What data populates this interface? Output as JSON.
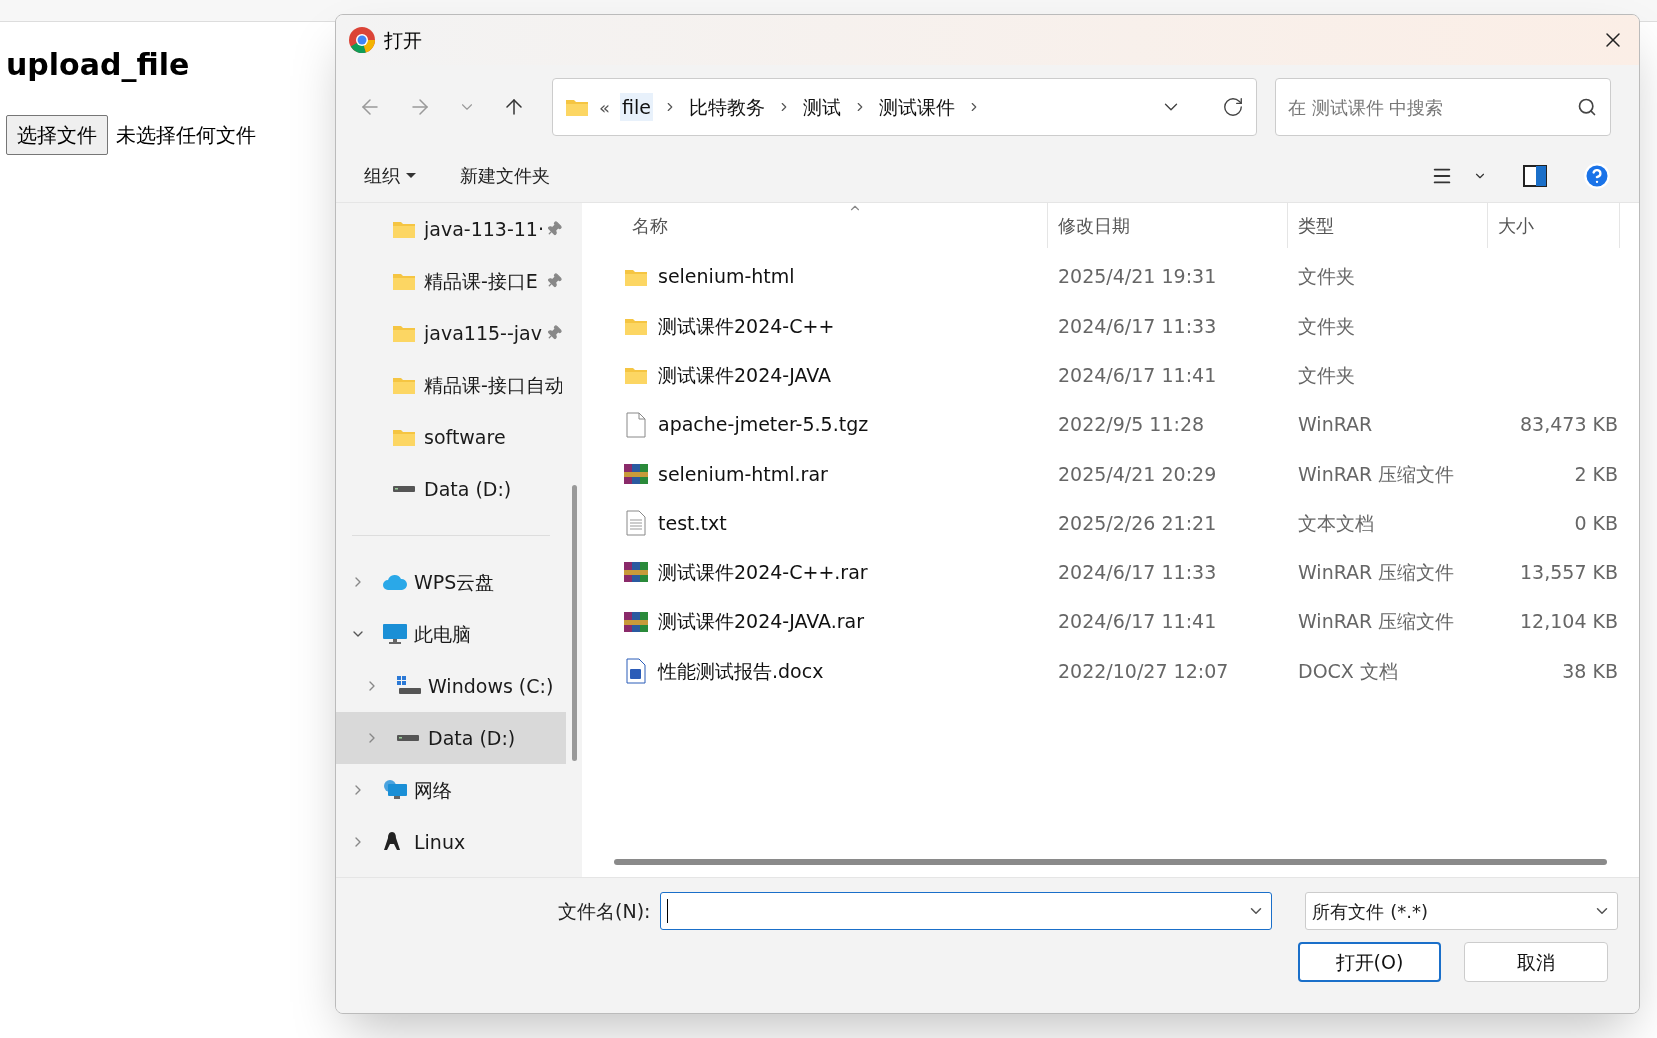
{
  "page": {
    "heading": "upload_file",
    "file_button": "选择文件",
    "file_status": "未选择任何文件"
  },
  "dialog": {
    "title": "打开",
    "breadcrumb": {
      "overflow": "«",
      "segments": [
        {
          "label": "file",
          "selected": true
        },
        {
          "label": "比特教务",
          "selected": false
        },
        {
          "label": "测试",
          "selected": false
        },
        {
          "label": "测试课件",
          "selected": false
        }
      ]
    },
    "search": {
      "placeholder": "在 测试课件 中搜索"
    },
    "toolbar": {
      "organize": "组织",
      "new_folder": "新建文件夹"
    },
    "quick_access": [
      {
        "label": "java-113-11·",
        "kind": "folder",
        "pinned": true
      },
      {
        "label": "精品课-接口E",
        "kind": "folder",
        "pinned": true
      },
      {
        "label": "java115--jav",
        "kind": "folder",
        "pinned": true
      },
      {
        "label": "精品课-接口自动",
        "kind": "folder",
        "pinned": false
      },
      {
        "label": "software",
        "kind": "folder",
        "pinned": false
      },
      {
        "label": "Data (D:)",
        "kind": "drive",
        "pinned": false
      }
    ],
    "tree": [
      {
        "label": "WPS云盘",
        "kind": "cloud",
        "expanded": false,
        "selected": false
      },
      {
        "label": "此电脑",
        "kind": "pc",
        "expanded": true,
        "selected": false,
        "children": [
          {
            "label": "Windows (C:)",
            "kind": "system-drive",
            "expanded": false,
            "selected": false
          },
          {
            "label": "Data (D:)",
            "kind": "drive",
            "expanded": false,
            "selected": true
          }
        ]
      },
      {
        "label": "网络",
        "kind": "network",
        "expanded": false,
        "selected": false
      },
      {
        "label": "Linux",
        "kind": "penguin",
        "expanded": false,
        "selected": false
      }
    ],
    "columns": [
      "名称",
      "修改日期",
      "类型",
      "大小"
    ],
    "files": [
      {
        "name": "selenium-html",
        "date": "2025/4/21 19:31",
        "type": "文件夹",
        "kind": "folder"
      },
      {
        "name": "测试课件2024-C++",
        "date": "2024/6/17 11:33",
        "type": "文件夹",
        "kind": "folder"
      },
      {
        "name": "测试课件2024-JAVA",
        "date": "2024/6/17 11:41",
        "type": "文件夹",
        "kind": "folder"
      },
      {
        "name": "apache-jmeter-5.5.tgz",
        "date": "2022/9/5 11:28",
        "type": "WinRAR",
        "size": "83,473 KB",
        "kind": "file"
      },
      {
        "name": "selenium-html.rar",
        "date": "2025/4/21 20:29",
        "type": "WinRAR 压缩文件",
        "size": "2 KB",
        "kind": "rar"
      },
      {
        "name": "test.txt",
        "date": "2025/2/26 21:21",
        "type": "文本文档",
        "size": "0 KB",
        "kind": "text"
      },
      {
        "name": "测试课件2024-C++.rar",
        "date": "2024/6/17 11:33",
        "type": "WinRAR 压缩文件",
        "size": "13,557 KB",
        "kind": "rar"
      },
      {
        "name": "测试课件2024-JAVA.rar",
        "date": "2024/6/17 11:41",
        "type": "WinRAR 压缩文件",
        "size": "12,104 KB",
        "kind": "rar"
      },
      {
        "name": "性能测试报告.docx",
        "date": "2022/10/27 12:07",
        "type": "DOCX 文档",
        "size": "38 KB",
        "kind": "docx"
      }
    ],
    "filename_label": "文件名(N):",
    "filter": "所有文件 (*.*)",
    "open_button": "打开(O)",
    "cancel_button": "取消"
  }
}
